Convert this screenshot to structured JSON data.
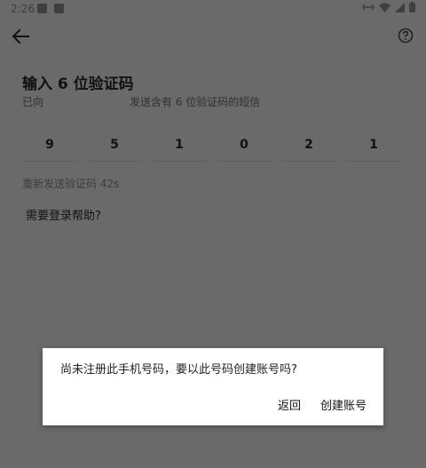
{
  "status_bar": {
    "time": "2:26"
  },
  "header": {
    "back_icon": "arrow-left-icon",
    "help_icon": "help-circle-icon"
  },
  "verification": {
    "title": "输入 6 位验证码",
    "sent_prefix": "已向",
    "sent_suffix": "发送含有 6 位验证码的短信",
    "digits": [
      "9",
      "5",
      "1",
      "0",
      "2",
      "1"
    ],
    "resend_text": "重新发送验证码 42s",
    "help_link": "需要登录帮助?"
  },
  "dialog": {
    "message": "尚未注册此手机号码，要以此号码创建账号吗?",
    "back_button": "返回",
    "create_button": "创建账号"
  },
  "colors": {
    "scrim_background": "#6a6a6a",
    "dialog_background": "#ffffff"
  }
}
